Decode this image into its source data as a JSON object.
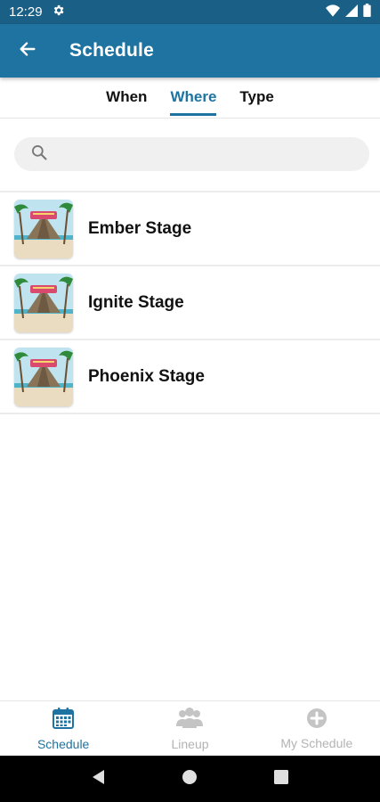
{
  "status_bar": {
    "time": "12:29"
  },
  "app_bar": {
    "title": "Schedule"
  },
  "tabs": [
    {
      "label": "When",
      "active": false
    },
    {
      "label": "Where",
      "active": true
    },
    {
      "label": "Type",
      "active": false
    }
  ],
  "search": {
    "placeholder": "",
    "value": ""
  },
  "stages": [
    {
      "name": "Ember Stage"
    },
    {
      "name": "Ignite Stage"
    },
    {
      "name": "Phoenix Stage"
    }
  ],
  "bottom_nav": [
    {
      "label": "Schedule",
      "icon": "calendar-icon",
      "active": true
    },
    {
      "label": "Lineup",
      "icon": "people-icon",
      "active": false
    },
    {
      "label": "My Schedule",
      "icon": "add-circle-icon",
      "active": false
    }
  ],
  "colors": {
    "primary": "#1e73a0",
    "status_bar": "#1a5f86",
    "inactive": "#b3b3b3"
  }
}
